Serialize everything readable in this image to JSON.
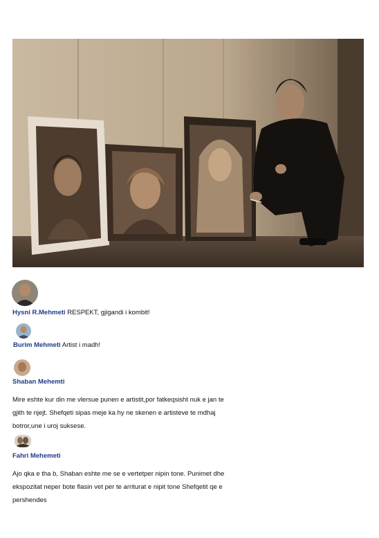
{
  "comments": [
    {
      "author": "Hysni R.Mehmeti",
      "text": "RESPEKT, gjigandi i kombit!"
    },
    {
      "author": "Burim Mehmeti",
      "text": "Artist i madh!"
    },
    {
      "author": "Shaban Mehemti",
      "text": ""
    },
    {
      "author": "Fahri Mehemeti",
      "text": ""
    }
  ],
  "paragraphs": {
    "shaban": [
      "Mire eshte kur din me vlersue punen e artistit,por fatkeqsisht nuk e jan te",
      "gjith te njejt. Shefqeti sipas meje ka hy ne skenen e artisteve te mdhaj",
      "botror,une i uroj suksese."
    ],
    "fahri": [
      "Ajo qka e tha b, Shaban eshte me se e vertetper nipin tone. Punimet dhe",
      "ekspozitat neper bote flasin vet per te arriturat e nipit tone Shefqetit qe e",
      "pershendes"
    ]
  }
}
